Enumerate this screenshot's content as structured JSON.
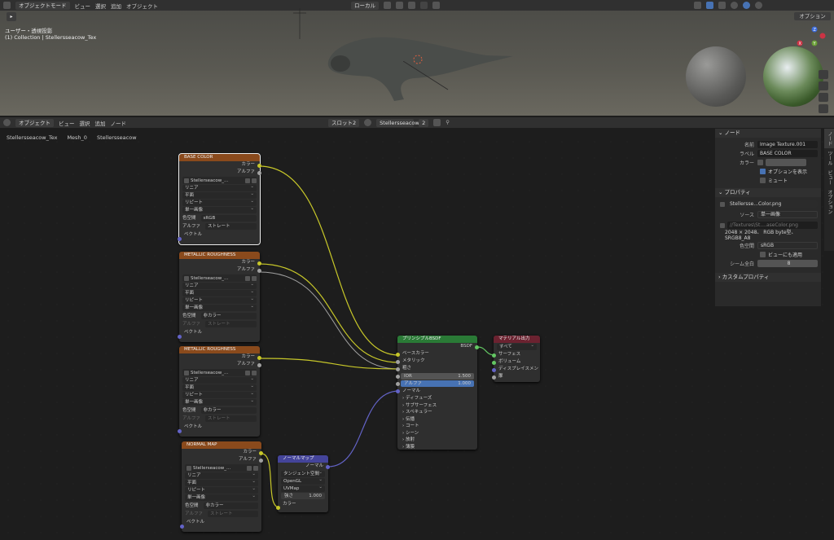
{
  "viewport": {
    "mode": "オブジェクトモード",
    "menus": [
      "ビュー",
      "選択",
      "追加",
      "オブジェクト"
    ],
    "transform": "ローカル",
    "options": "オプション",
    "view_label": "ユーザー・透視投影",
    "collection_label": "(1) Collection | Stellersseacow_Tex",
    "gizmo_axes": [
      "Z",
      "X",
      "Y"
    ]
  },
  "node_editor": {
    "type": "オブジェクト",
    "menus": [
      "ビュー",
      "選択",
      "追加",
      "ノード"
    ],
    "slot": "スロット2",
    "material": "Stellersseacow",
    "users": "2",
    "breadcrumb": [
      "Stellersseacow_Tex",
      "Mesh_0",
      "Stellersseacow"
    ]
  },
  "nodes": {
    "base_color": {
      "title": "BASE COLOR",
      "out_color": "カラー",
      "out_alpha": "アルファ",
      "image": "Stellerseacow_...",
      "interp": "リニア",
      "proj": "平面",
      "ext": "リピート",
      "source": "単一画像",
      "cs_label": "色空間",
      "cs": "sRGB",
      "alpha_label": "アルファ",
      "alpha": "ストレート",
      "vector": "ベクトル"
    },
    "metal1": {
      "title": "METALLIC ROUGHNESS",
      "out_color": "カラー",
      "out_alpha": "アルファ",
      "image": "Stellerseacow_...",
      "interp": "リニア",
      "proj": "平面",
      "ext": "リピート",
      "source": "単一画像",
      "cs_label": "色空間",
      "cs": "非カラー",
      "alpha_label": "アルファ",
      "alpha": "ストレート",
      "vector": "ベクトル"
    },
    "metal2": {
      "title": "METALLIC ROUGHNESS",
      "out_color": "カラー",
      "out_alpha": "アルファ",
      "image": "Stellerseacow_...",
      "interp": "リニア",
      "proj": "平面",
      "ext": "リピート",
      "source": "単一画像",
      "cs_label": "色空間",
      "cs": "非カラー",
      "alpha_label": "アルファ",
      "alpha": "ストレート",
      "vector": "ベクトル"
    },
    "normal": {
      "title": "NORMAL MAP",
      "out_color": "カラー",
      "out_alpha": "アルファ",
      "image": "Stellerseacow_...",
      "interp": "リニア",
      "proj": "平面",
      "ext": "リピート",
      "source": "単一画像",
      "cs_label": "色空間",
      "cs": "非カラー",
      "alpha_label": "アルファ",
      "alpha": "ストレート",
      "vector": "ベクトル"
    },
    "normalmap": {
      "title": "ノーマルマップ",
      "out": "ノーマル",
      "space": "タンジェント空間",
      "conv": "OpenGL",
      "uv": "UVMap",
      "strength_label": "強さ",
      "strength": "1.000",
      "color": "カラー"
    },
    "bsdf": {
      "title": "プリンシプルBSDF",
      "out": "BSDF",
      "base": "ベースカラー",
      "metal": "メタリック",
      "rough": "粗さ",
      "ior_label": "IOR",
      "ior": "1.500",
      "alpha_label": "アルファ",
      "alpha": "1.000",
      "normal": "ノーマル",
      "sections": [
        "ディフューズ",
        "サブサーフェス",
        "スペキュラー",
        "伝播",
        "コート",
        "シーン",
        "放射",
        "薄膜"
      ]
    },
    "output": {
      "title": "マテリアル出力",
      "target": "すべて",
      "surface": "サーフェス",
      "volume": "ボリューム",
      "disp": "ディスプレイスメント",
      "thick": "厚"
    }
  },
  "panel": {
    "node_section": "ノード",
    "name_label": "名前",
    "name": "Image Texture.001",
    "label_label": "ラベル",
    "label": "BASE COLOR",
    "color_label": "カラー",
    "show_options": "オプションを表示",
    "mute": "ミュート",
    "props_section": "プロパティ",
    "image_name": "Stellersse...Color.png",
    "source_label": "ソース",
    "source": "単一画像",
    "path": "//Textures\\St....aseColor.png",
    "info": "2048 × 2048、 RGB byte型、SRGB8_A8",
    "cs_label": "色空間",
    "cs": "sRGB",
    "view_as_render": "ビューにも適用",
    "tiles_label": "シーム全白",
    "tiles": "8",
    "custom_props": "カスタムプロパティ",
    "tabs": [
      "ノード",
      "ツール",
      "ビュー",
      "オプション"
    ]
  },
  "colors": {
    "image_node": "#8a4a1c",
    "shader_node": "#2a7a36",
    "output_node": "#6b2230",
    "vector_node": "#44449a",
    "accent": "#4772b3"
  }
}
